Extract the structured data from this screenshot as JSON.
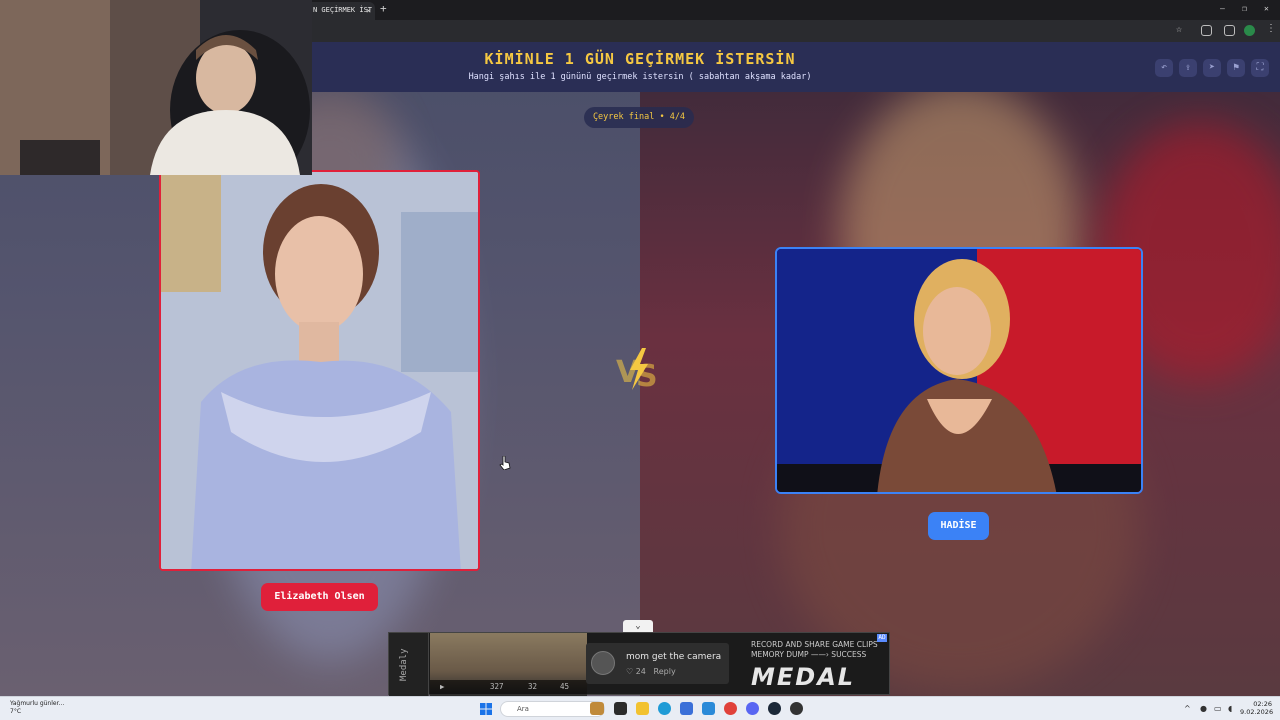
{
  "browser": {
    "tab_title": "N GEÇİRMEK İST",
    "tab_close": "✕",
    "new_tab": "+",
    "window_controls": [
      "—",
      "❐",
      "✕"
    ]
  },
  "page": {
    "title": "KİMİNLE 1 GÜN GEÇİRMEK İSTERSİN",
    "subtitle": "Hangi şahıs ile 1 gününü geçirmek istersin ( sabahtan akşama kadar)",
    "round": "Çeyrek final • 4/4",
    "header_buttons": [
      "undo-icon",
      "share-icon",
      "send-icon",
      "flag-icon",
      "fullscreen-icon"
    ],
    "left_choice": "Elizabeth Olsen",
    "right_choice": "HADİSE",
    "vs": "VS"
  },
  "colors": {
    "accent_gold": "#f5c842",
    "left_red": "#e0203a",
    "right_blue": "#3b82f6",
    "header_bg": "#2a2e55"
  },
  "ad": {
    "side_label": "Medaly",
    "comment_text": "mom get the camera",
    "likes": "24",
    "reply": "Reply",
    "video_stats": [
      "327",
      "32",
      "45"
    ],
    "tagline_1": "RECORD AND SHARE GAME CLIPS",
    "tagline_2": "MEMORY DUMP ——› SUCCESS",
    "logo": "MEDAL",
    "close": "AD"
  },
  "taskbar": {
    "weather_line1": "Yağmurlu günler...",
    "weather_line2": "7°C",
    "search_placeholder": "Ara",
    "time": "02:26",
    "date": "9.02.2026"
  }
}
